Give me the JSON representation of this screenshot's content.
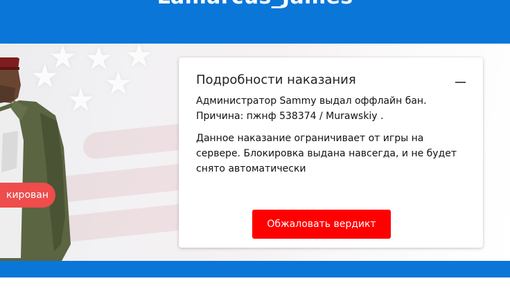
{
  "header": {
    "player_name": "Lamarcus_James",
    "accent_color": "#0a76d8"
  },
  "banner": {
    "status_label": "кирован",
    "background_icons": [
      "star-icon",
      "flag-icon"
    ],
    "character": "player-skin-image"
  },
  "punishment_card": {
    "title": "Подробности наказания",
    "collapse_icon": "minus-icon",
    "admin_line": "Администратор Sammy выдал оффлайн бан.",
    "reason_line": "Причина: пжнф 538374 / Murawskiy .",
    "description": "Данное наказание ограничивает от игры на сервере. Блокировка выдана навсегда, и не будет снято автоматически",
    "appeal_button_label": "Обжаловать вердикт",
    "button_color": "#ff0000"
  }
}
